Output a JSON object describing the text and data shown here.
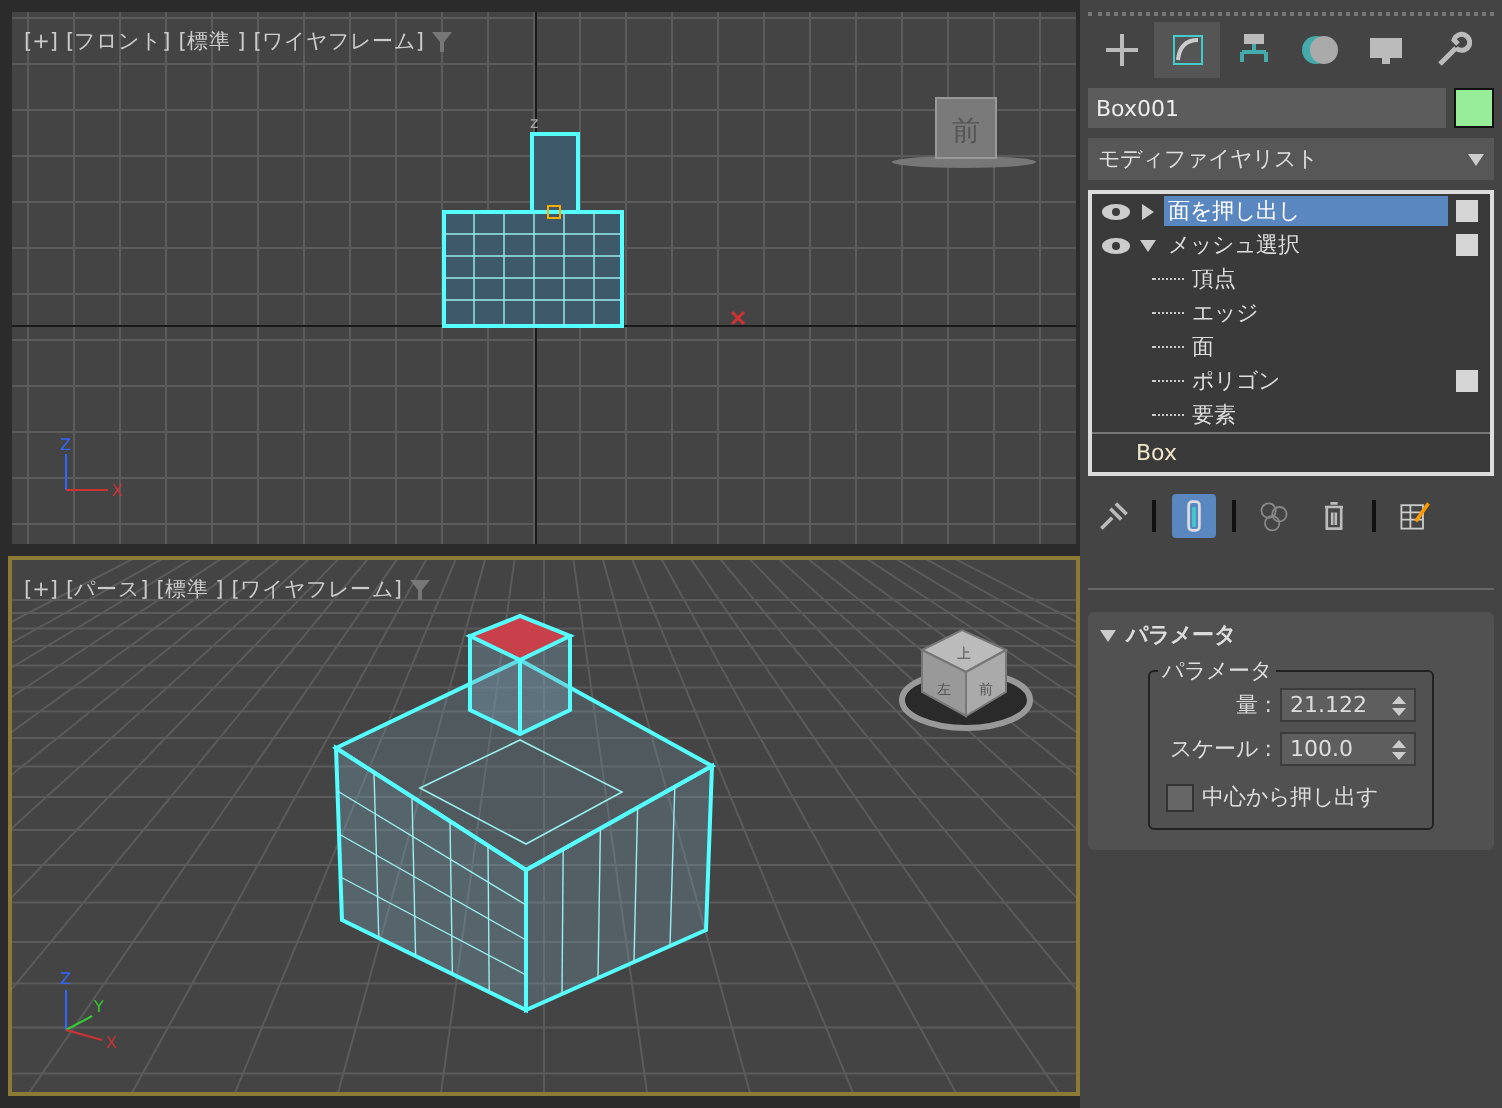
{
  "viewports": [
    {
      "kind": "front",
      "active": false,
      "labels": [
        "[+]",
        "[フロント]",
        "[標準 ]",
        "[ワイヤフレーム]"
      ],
      "viewcube": [
        "前"
      ],
      "axis_labels": [
        "z"
      ],
      "gizmo": [
        "Z",
        "X"
      ]
    },
    {
      "kind": "perspective",
      "active": true,
      "labels": [
        "[+]",
        "[パース]",
        "[標準 ]",
        "[ワイヤフレーム]"
      ],
      "viewcube": [
        "上",
        "左",
        "前"
      ],
      "gizmo": [
        "Z",
        "Y",
        "X"
      ]
    }
  ],
  "command_panel": {
    "tabs": [
      {
        "kind": "create",
        "selected": false
      },
      {
        "kind": "modify",
        "selected": true
      },
      {
        "kind": "hierarchy",
        "selected": false
      },
      {
        "kind": "motion",
        "selected": false
      },
      {
        "kind": "display",
        "selected": false
      },
      {
        "kind": "utilities",
        "selected": false
      }
    ],
    "object_name": "Box001",
    "modifier_list": "モディファイヤリスト",
    "stack": [
      {
        "label": "面を押し出し",
        "selected": true,
        "expanded": false,
        "marker": true
      },
      {
        "label": "メッシュ選択",
        "selected": false,
        "expanded": true,
        "marker": true,
        "children": [
          {
            "label": "頂点",
            "marker": false
          },
          {
            "label": "エッジ",
            "marker": false
          },
          {
            "label": "面",
            "marker": false
          },
          {
            "label": "ポリゴン",
            "marker": true
          },
          {
            "label": "要素",
            "marker": false
          }
        ]
      }
    ],
    "base_object": "Box",
    "stack_tools": [
      {
        "kind": "pin",
        "selected": false
      },
      {
        "kind": "show-end-result",
        "selected": true
      },
      {
        "kind": "make-unique",
        "selected": false
      },
      {
        "kind": "remove",
        "selected": false
      },
      {
        "kind": "configure",
        "selected": false
      }
    ],
    "rollout": {
      "title": "パラメータ",
      "expanded": true,
      "group": "パラメータ",
      "fields": [
        {
          "label": "量 :",
          "value": "21.122"
        },
        {
          "label": "スケール :",
          "value": "100.0"
        }
      ],
      "checkbox": {
        "label": "中心から押し出す",
        "checked": false
      }
    }
  }
}
